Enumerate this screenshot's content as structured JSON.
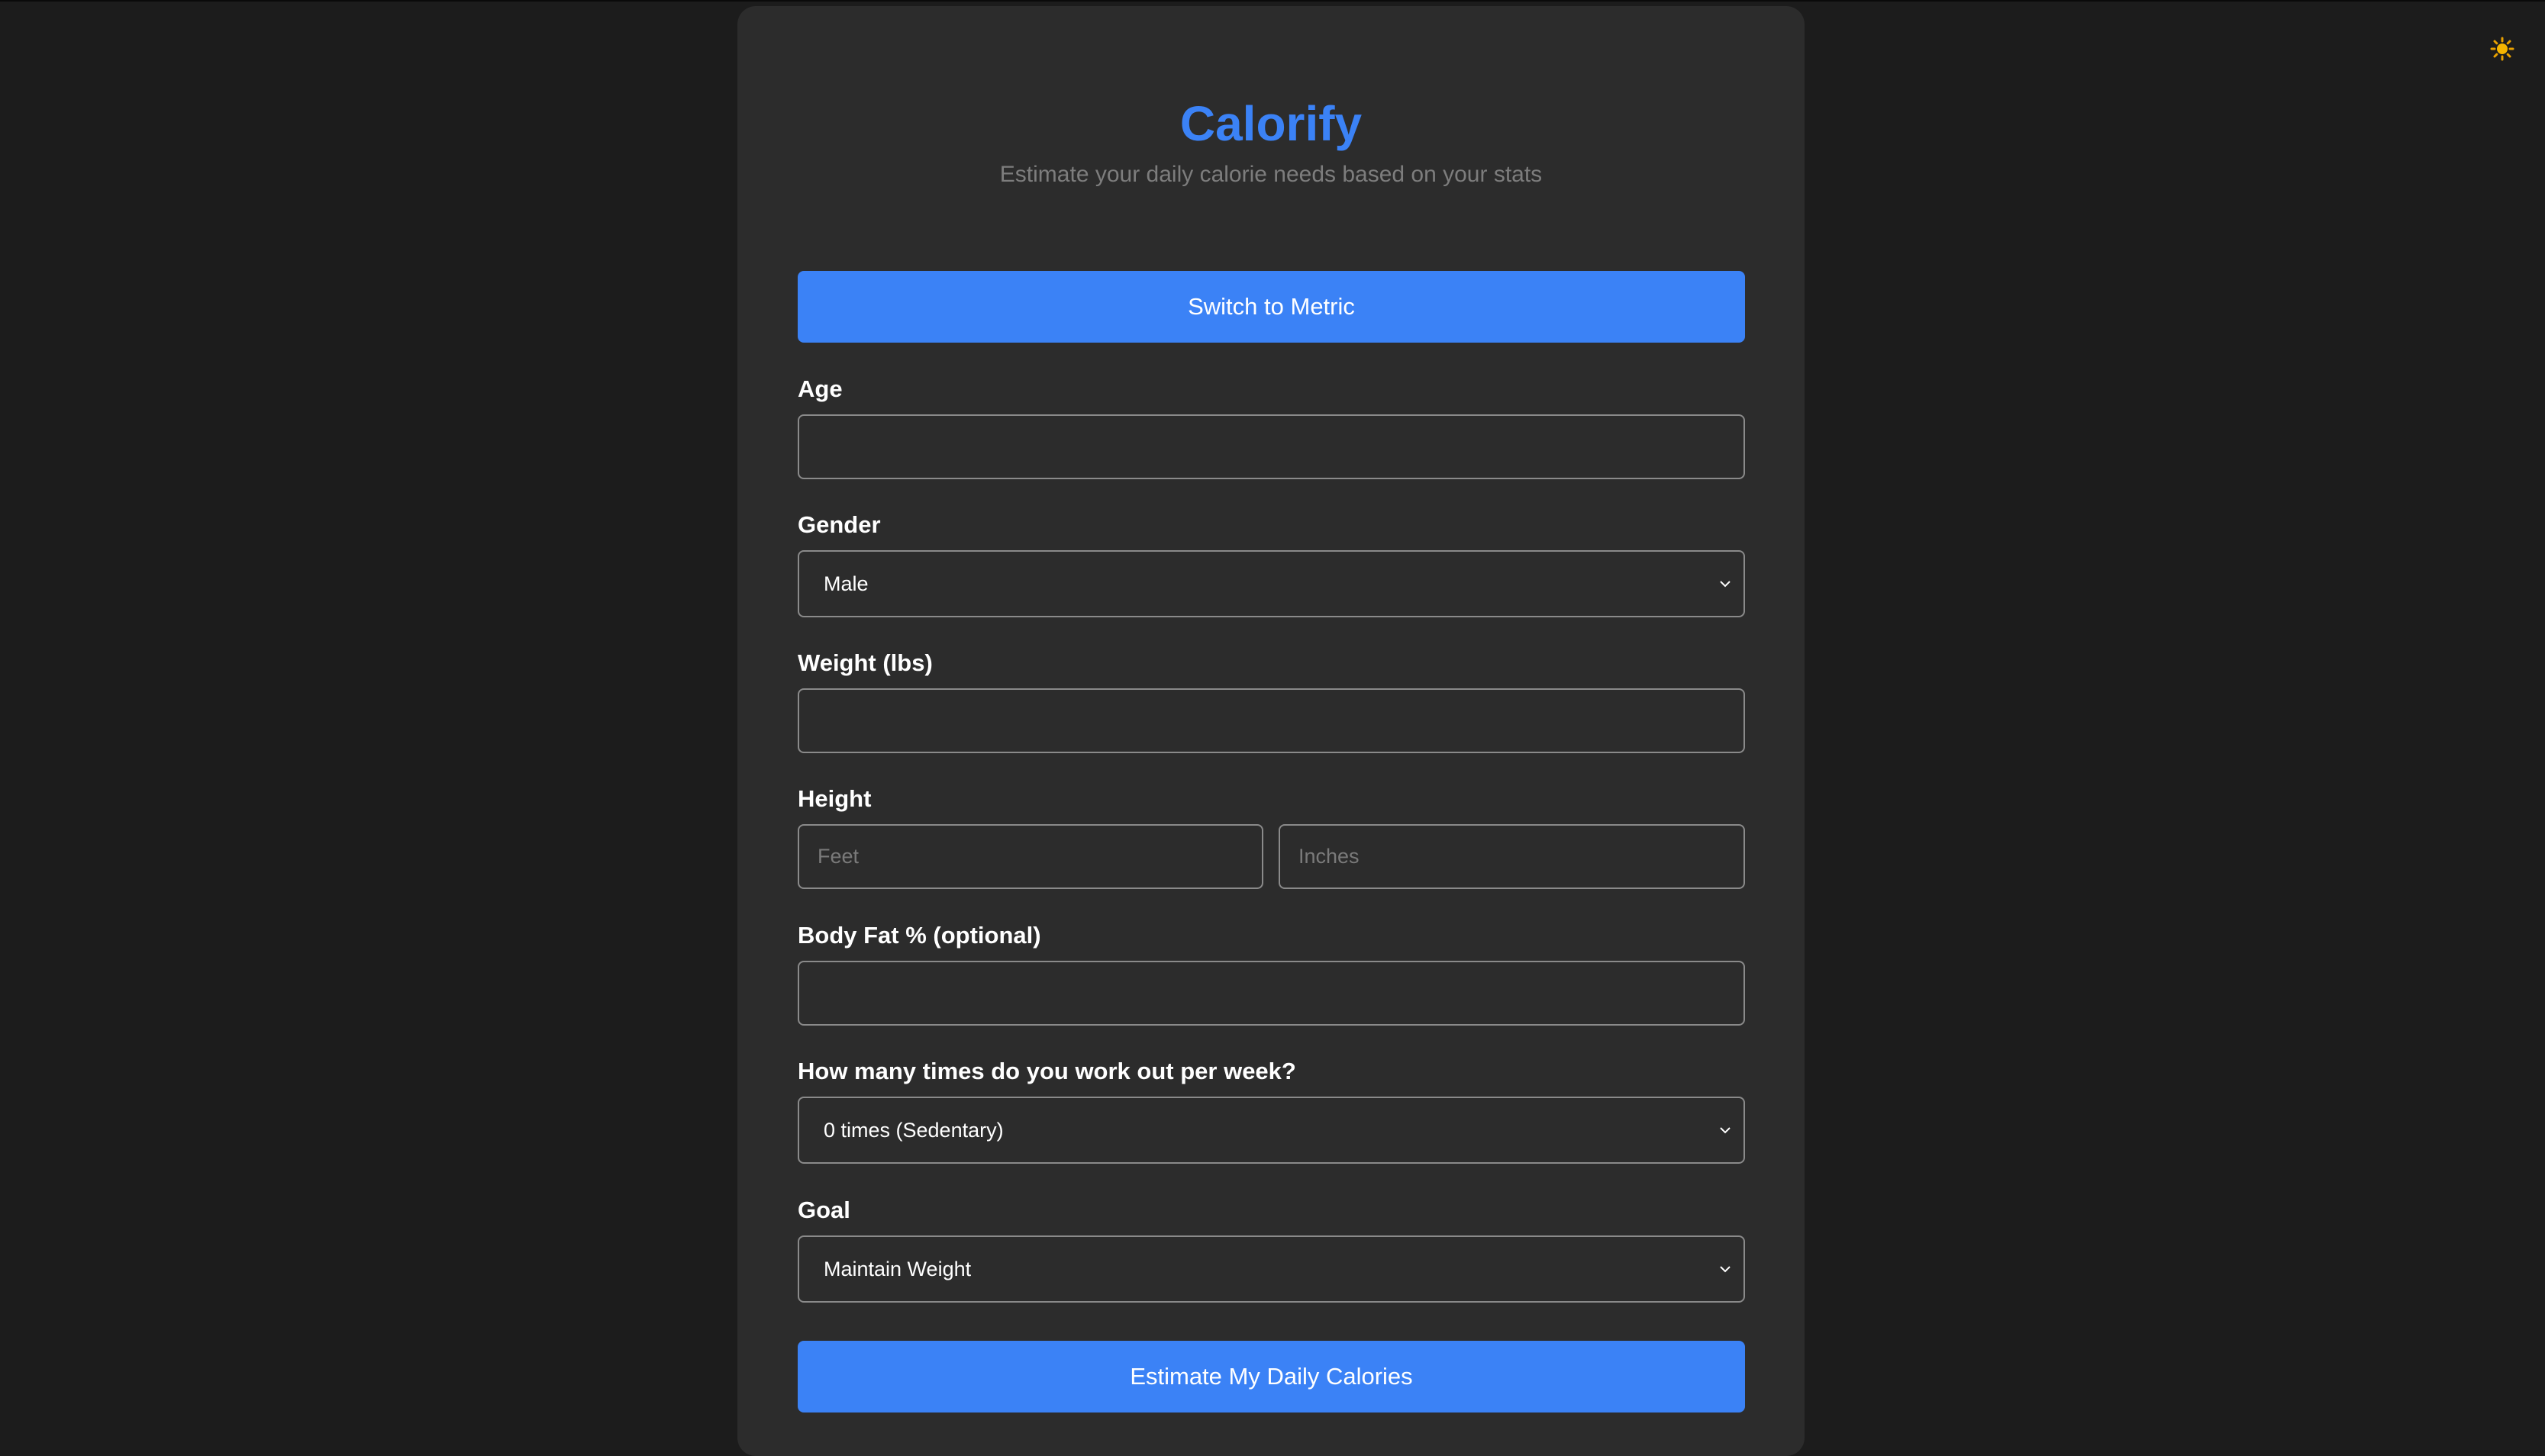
{
  "app": {
    "title": "Calorify",
    "subtitle": "Estimate your daily calorie needs based on your stats"
  },
  "theme_toggle": {
    "icon": "sun-icon"
  },
  "unit_toggle": {
    "label": "Switch to Metric"
  },
  "form": {
    "age": {
      "label": "Age",
      "value": "",
      "placeholder": ""
    },
    "gender": {
      "label": "Gender",
      "selected": "Male"
    },
    "weight": {
      "label": "Weight (lbs)",
      "value": "",
      "placeholder": ""
    },
    "height": {
      "label": "Height",
      "feet_placeholder": "Feet",
      "inches_placeholder": "Inches"
    },
    "body_fat": {
      "label": "Body Fat % (optional)",
      "value": "",
      "placeholder": ""
    },
    "workouts": {
      "label": "How many times do you work out per week?",
      "selected": "0 times (Sedentary)"
    },
    "goal": {
      "label": "Goal",
      "selected": "Maintain Weight"
    }
  },
  "submit": {
    "label": "Estimate My Daily Calories"
  },
  "colors": {
    "accent": "#3b82f6",
    "background": "#1c1c1c",
    "card": "#2c2c2c",
    "border": "#8a8a8a",
    "sun": "#f5b400"
  }
}
